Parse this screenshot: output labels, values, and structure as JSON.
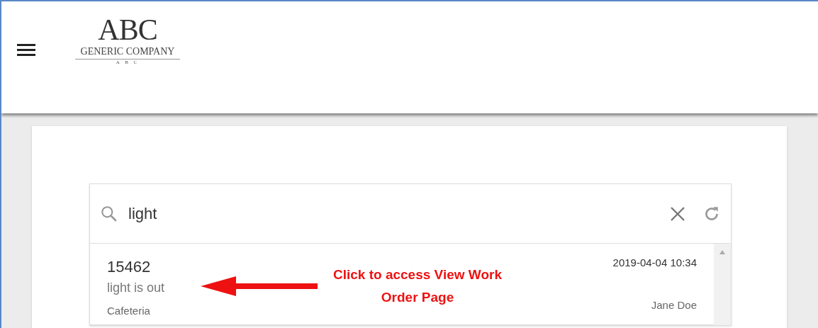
{
  "header": {
    "logo": {
      "mark": "ABC",
      "name": "GENERIC COMPANY",
      "tagline": "A B C"
    }
  },
  "search": {
    "value": "light"
  },
  "results": [
    {
      "number": "15462",
      "description": "light is out",
      "location": "Cafeteria",
      "date": "2019-04-04 10:34",
      "assignee": "Jane Doe"
    }
  ],
  "annotation": {
    "text": "Click to access View Work Order Page"
  }
}
